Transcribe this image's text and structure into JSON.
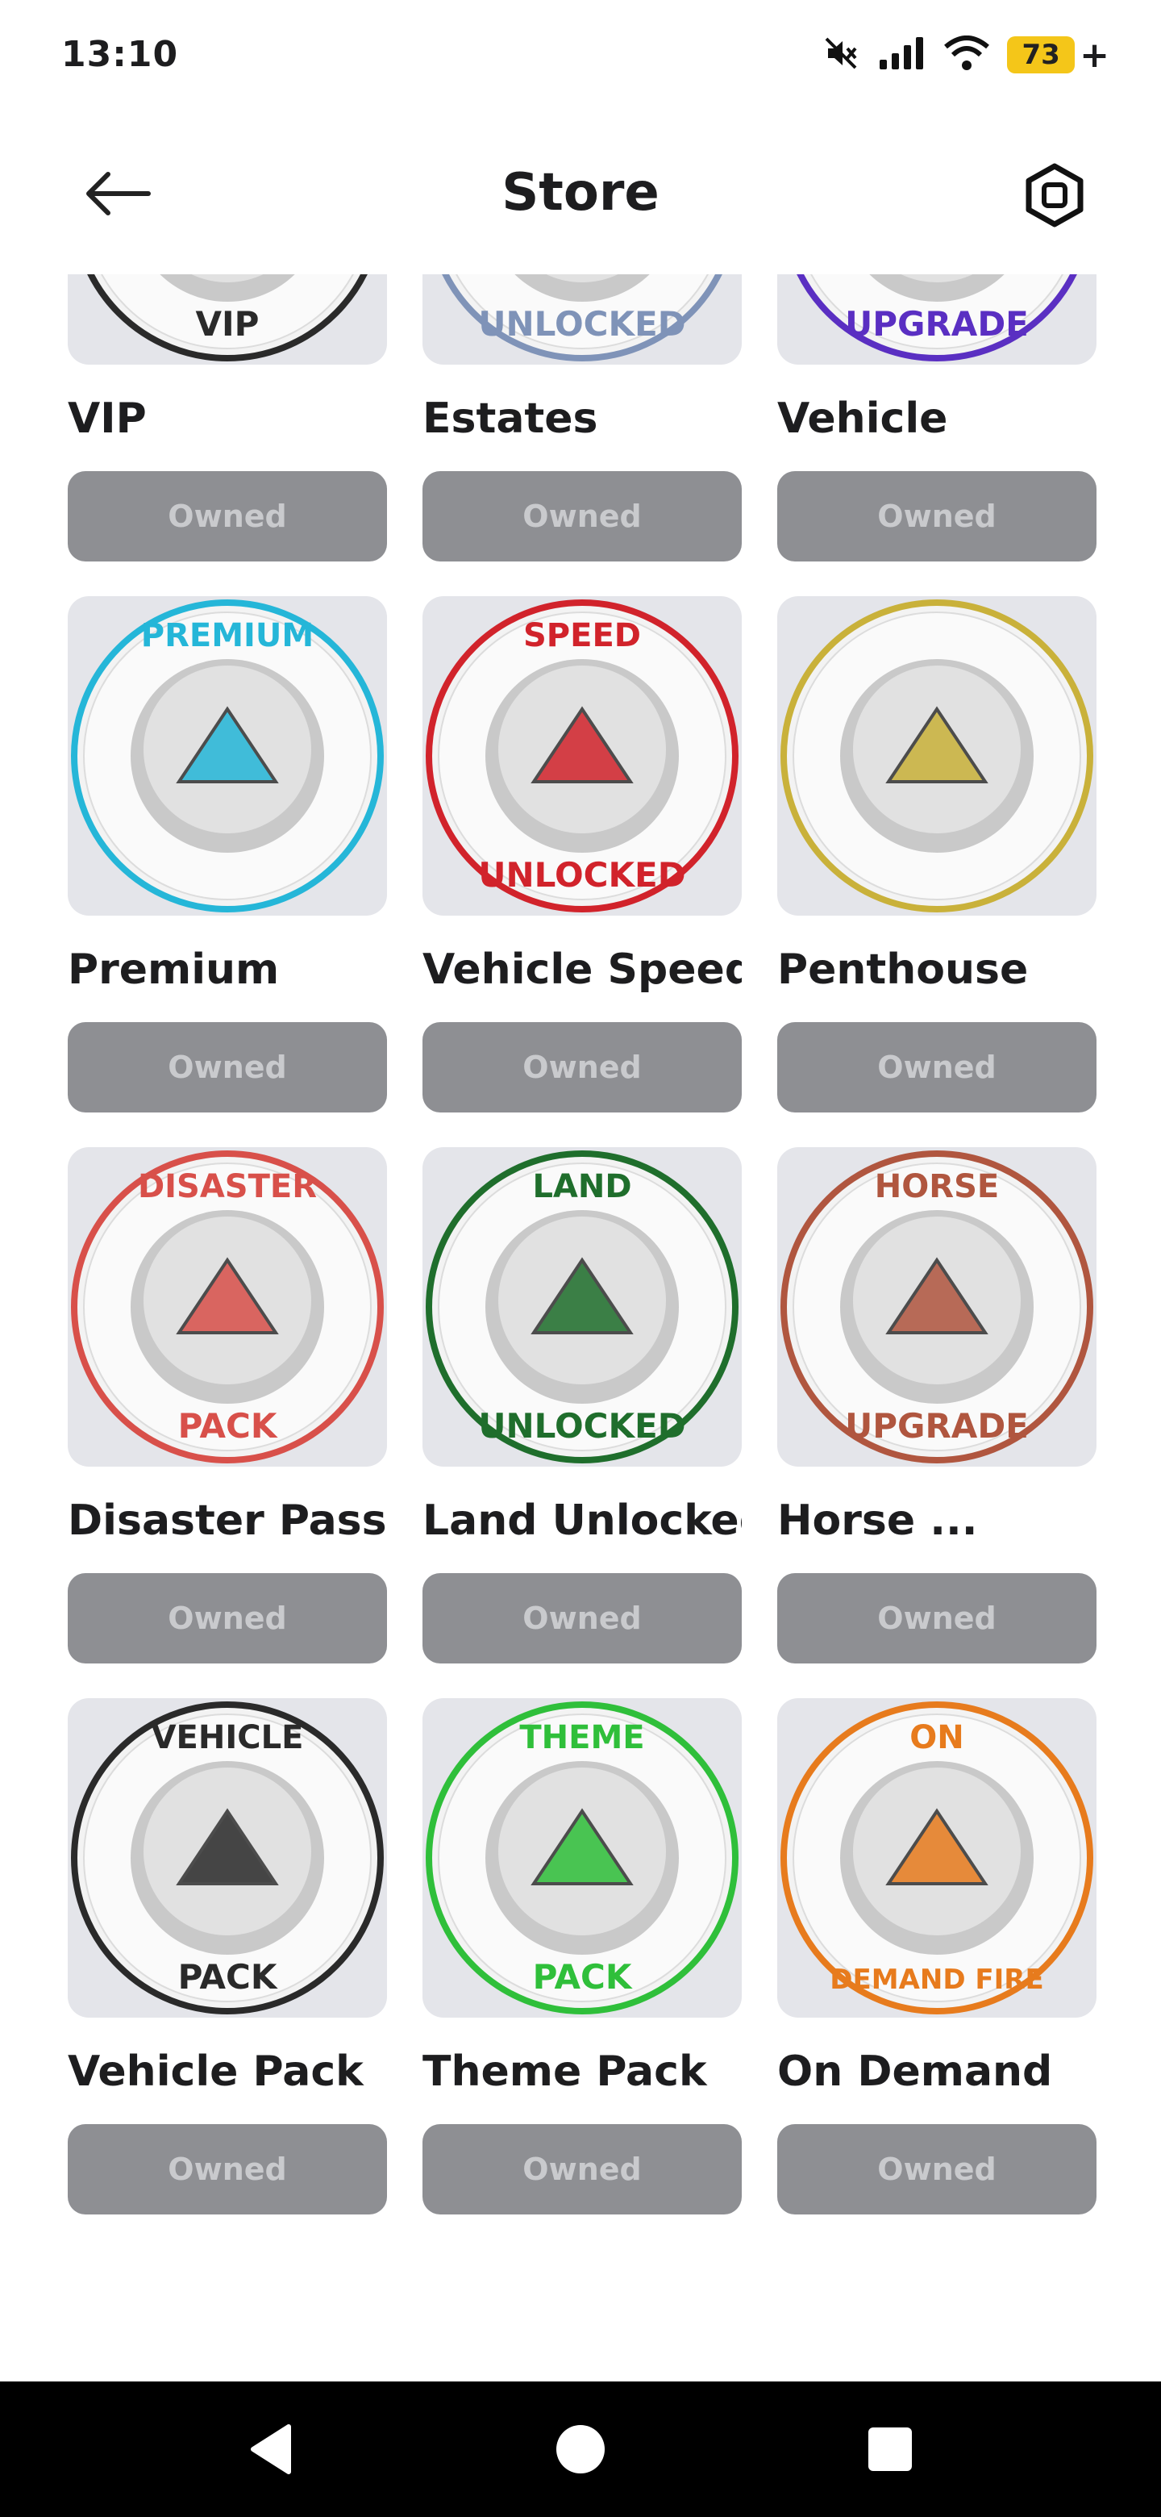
{
  "status_bar": {
    "time": "13:10",
    "battery": "73",
    "battery_suffix": "+",
    "icons": [
      "mute-icon",
      "signal-icon",
      "wifi-icon",
      "battery-icon"
    ]
  },
  "header": {
    "title": "Store",
    "back_icon": "arrow-left-icon",
    "robux_icon": "robux-icon"
  },
  "items": [
    {
      "name": "VIP",
      "badge_text": [
        "",
        "VIP"
      ],
      "ring_color": "#2a2a2a",
      "button": "Owned"
    },
    {
      "name": "Estates",
      "badge_text": [
        "",
        "UNLOCKED"
      ],
      "ring_color": "#7f93b8",
      "button": "Owned"
    },
    {
      "name": "Vehicle",
      "badge_text": [
        "",
        "UPGRADE"
      ],
      "ring_color": "#5a2fc2",
      "button": "Owned"
    },
    {
      "name": "Premium",
      "badge_text": [
        "PREMIUM",
        ""
      ],
      "ring_color": "#25b6d8",
      "button": "Owned"
    },
    {
      "name": "Vehicle Speed",
      "badge_text": [
        "SPEED",
        "UNLOCKED"
      ],
      "ring_color": "#d1232b",
      "button": "Owned"
    },
    {
      "name": "Penthouse",
      "badge_text": [
        "",
        ""
      ],
      "ring_color": "#c9b13a",
      "button": "Owned"
    },
    {
      "name": "Disaster Pass",
      "badge_text": [
        "DISASTER",
        "PACK"
      ],
      "ring_color": "#d8504a",
      "button": "Owned"
    },
    {
      "name": "Land Unlocked",
      "badge_text": [
        "LAND",
        "UNLOCKED"
      ],
      "ring_color": "#1f6e2c",
      "button": "Owned"
    },
    {
      "name": "Horse ...",
      "badge_text": [
        "HORSE",
        "UPGRADE"
      ],
      "ring_color": "#b0563f",
      "button": "Owned"
    },
    {
      "name": "Vehicle Pack",
      "badge_text": [
        "VEHICLE",
        "PACK"
      ],
      "ring_color": "#2a2a2a",
      "button": "Owned"
    },
    {
      "name": "Theme Pack",
      "badge_text": [
        "THEME",
        "PACK"
      ],
      "ring_color": "#2fbf3a",
      "button": "Owned"
    },
    {
      "name": "On Demand",
      "badge_text": [
        "ON",
        "DEMAND FIRE"
      ],
      "ring_color": "#e77b1d",
      "button": "Owned"
    }
  ],
  "nav": {
    "back": "nav-back-icon",
    "home": "nav-home-icon",
    "recents": "nav-recents-icon"
  }
}
